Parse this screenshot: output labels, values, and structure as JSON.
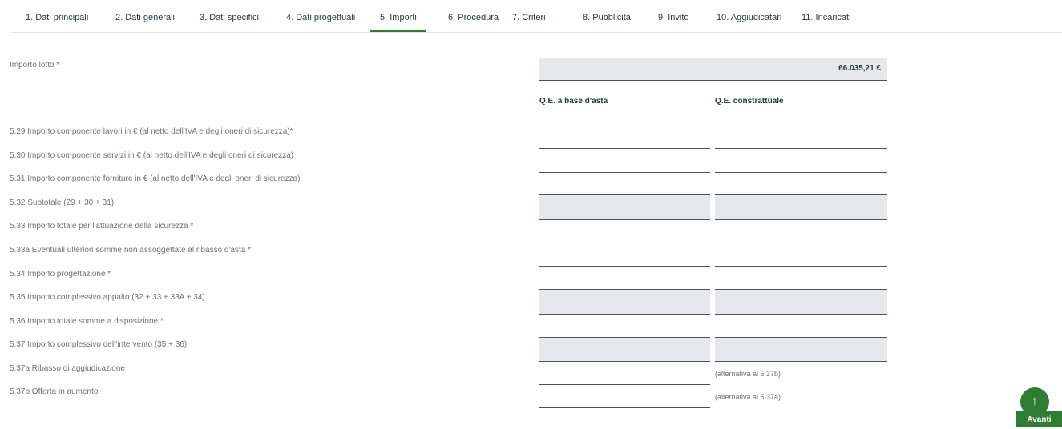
{
  "tabs": [
    {
      "label": "1. Dati principali"
    },
    {
      "label": "2. Dati generali"
    },
    {
      "label": "3. Dati specifici"
    },
    {
      "label": "4. Dati progettuali"
    },
    {
      "label": "5. Importi"
    },
    {
      "label": "6. Procedura"
    },
    {
      "label": "7. Criteri"
    },
    {
      "label": "8. Pubblicità"
    },
    {
      "label": "9. Invito"
    },
    {
      "label": "10. Aggiudicatari"
    },
    {
      "label": "11. Incaricati"
    }
  ],
  "active_tab": "5. Importi",
  "importo_lotto": {
    "label": "Importo lotto *",
    "value": "66.035,21 €"
  },
  "columns": {
    "base_asta": "Q.E. a base d'asta",
    "contrattuale": "Q.E. constrattuale"
  },
  "rows": [
    {
      "label": "5.29 Importo componente lavori in € (al netto dell'IVA e degli oneri di sicurezza)*"
    },
    {
      "label": "5.30 Importo componente servizi in € (al netto dell'IVA e degli oneri di sicurezza)"
    },
    {
      "label": "5.31 Importo componente forniture in € (al netto dell'IVA e degli oneri di sicurezza)"
    },
    {
      "label": "5.32 Subtotale (29 + 30 + 31)"
    },
    {
      "label": "5.33 Importo totale per l'attuazione della sicurezza *"
    },
    {
      "label": "5.33a Eventuali ulteriori somme non assoggettate al ribasso d'asta *"
    },
    {
      "label": "5.34 Importo progettazione *"
    },
    {
      "label": "5.35 Importo complessivo appalto (32 + 33 + 33A + 34)"
    },
    {
      "label": "5.36 Importo totale somme a disposizione *"
    },
    {
      "label": "5.37 Importo complessivo dell'intervento (35 + 36)"
    },
    {
      "label": "5.37a Ribasso di aggiudicazione"
    },
    {
      "label": "5.37b Offerta in aumento"
    }
  ],
  "hints": {
    "ribasso": "(alternativa al 5.37b)",
    "offerta": "(alternativa al 5.37a)"
  },
  "avanti": {
    "label": "Avanti",
    "icon": "arrow-up-icon"
  },
  "colors": {
    "accent": "#2e7d32",
    "field_gray": "#e6e8ec"
  }
}
